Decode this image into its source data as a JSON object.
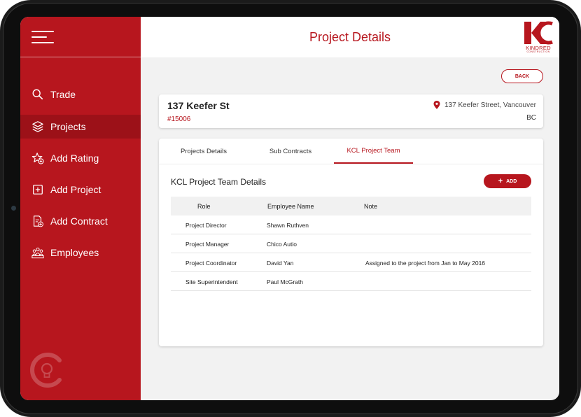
{
  "header": {
    "title": "Project Details",
    "logo_text": "KINDRED",
    "logo_sub": "CONSTRUCTION"
  },
  "sidebar": {
    "items": [
      {
        "label": "Trade",
        "icon": "search-icon"
      },
      {
        "label": "Projects",
        "icon": "layers-icon",
        "active": true
      },
      {
        "label": "Add Rating",
        "icon": "add-rating-icon"
      },
      {
        "label": "Add Project",
        "icon": "add-project-icon"
      },
      {
        "label": "Add Contract",
        "icon": "add-contract-icon"
      },
      {
        "label": "Employees",
        "icon": "employees-icon"
      }
    ]
  },
  "back_label": "BACK",
  "project": {
    "name": "137 Keefer St",
    "number": "#15006",
    "address": "137 Keefer Street, Vancouver",
    "province": "BC"
  },
  "tabs": [
    {
      "label": "Projects Details"
    },
    {
      "label": "Sub Contracts"
    },
    {
      "label": "KCL Project Team",
      "active": true
    }
  ],
  "team": {
    "title": "KCL Project Team Details",
    "add_label": "ADD",
    "columns": [
      "Role",
      "Employee Name",
      "Note"
    ],
    "rows": [
      {
        "role": "Project Director",
        "name": "Shawn Ruthven",
        "note": ""
      },
      {
        "role": "Project Manager",
        "name": "Chico Autio",
        "note": ""
      },
      {
        "role": "Project Coordinator",
        "name": "David Yan",
        "note": "Assigned to the project from Jan to May 2016"
      },
      {
        "role": "Site Superintendent",
        "name": "Paul McGrath",
        "note": ""
      }
    ]
  },
  "colors": {
    "brand": "#b7161e",
    "brand_dark": "#9c1118",
    "background": "#f2f2f2"
  }
}
